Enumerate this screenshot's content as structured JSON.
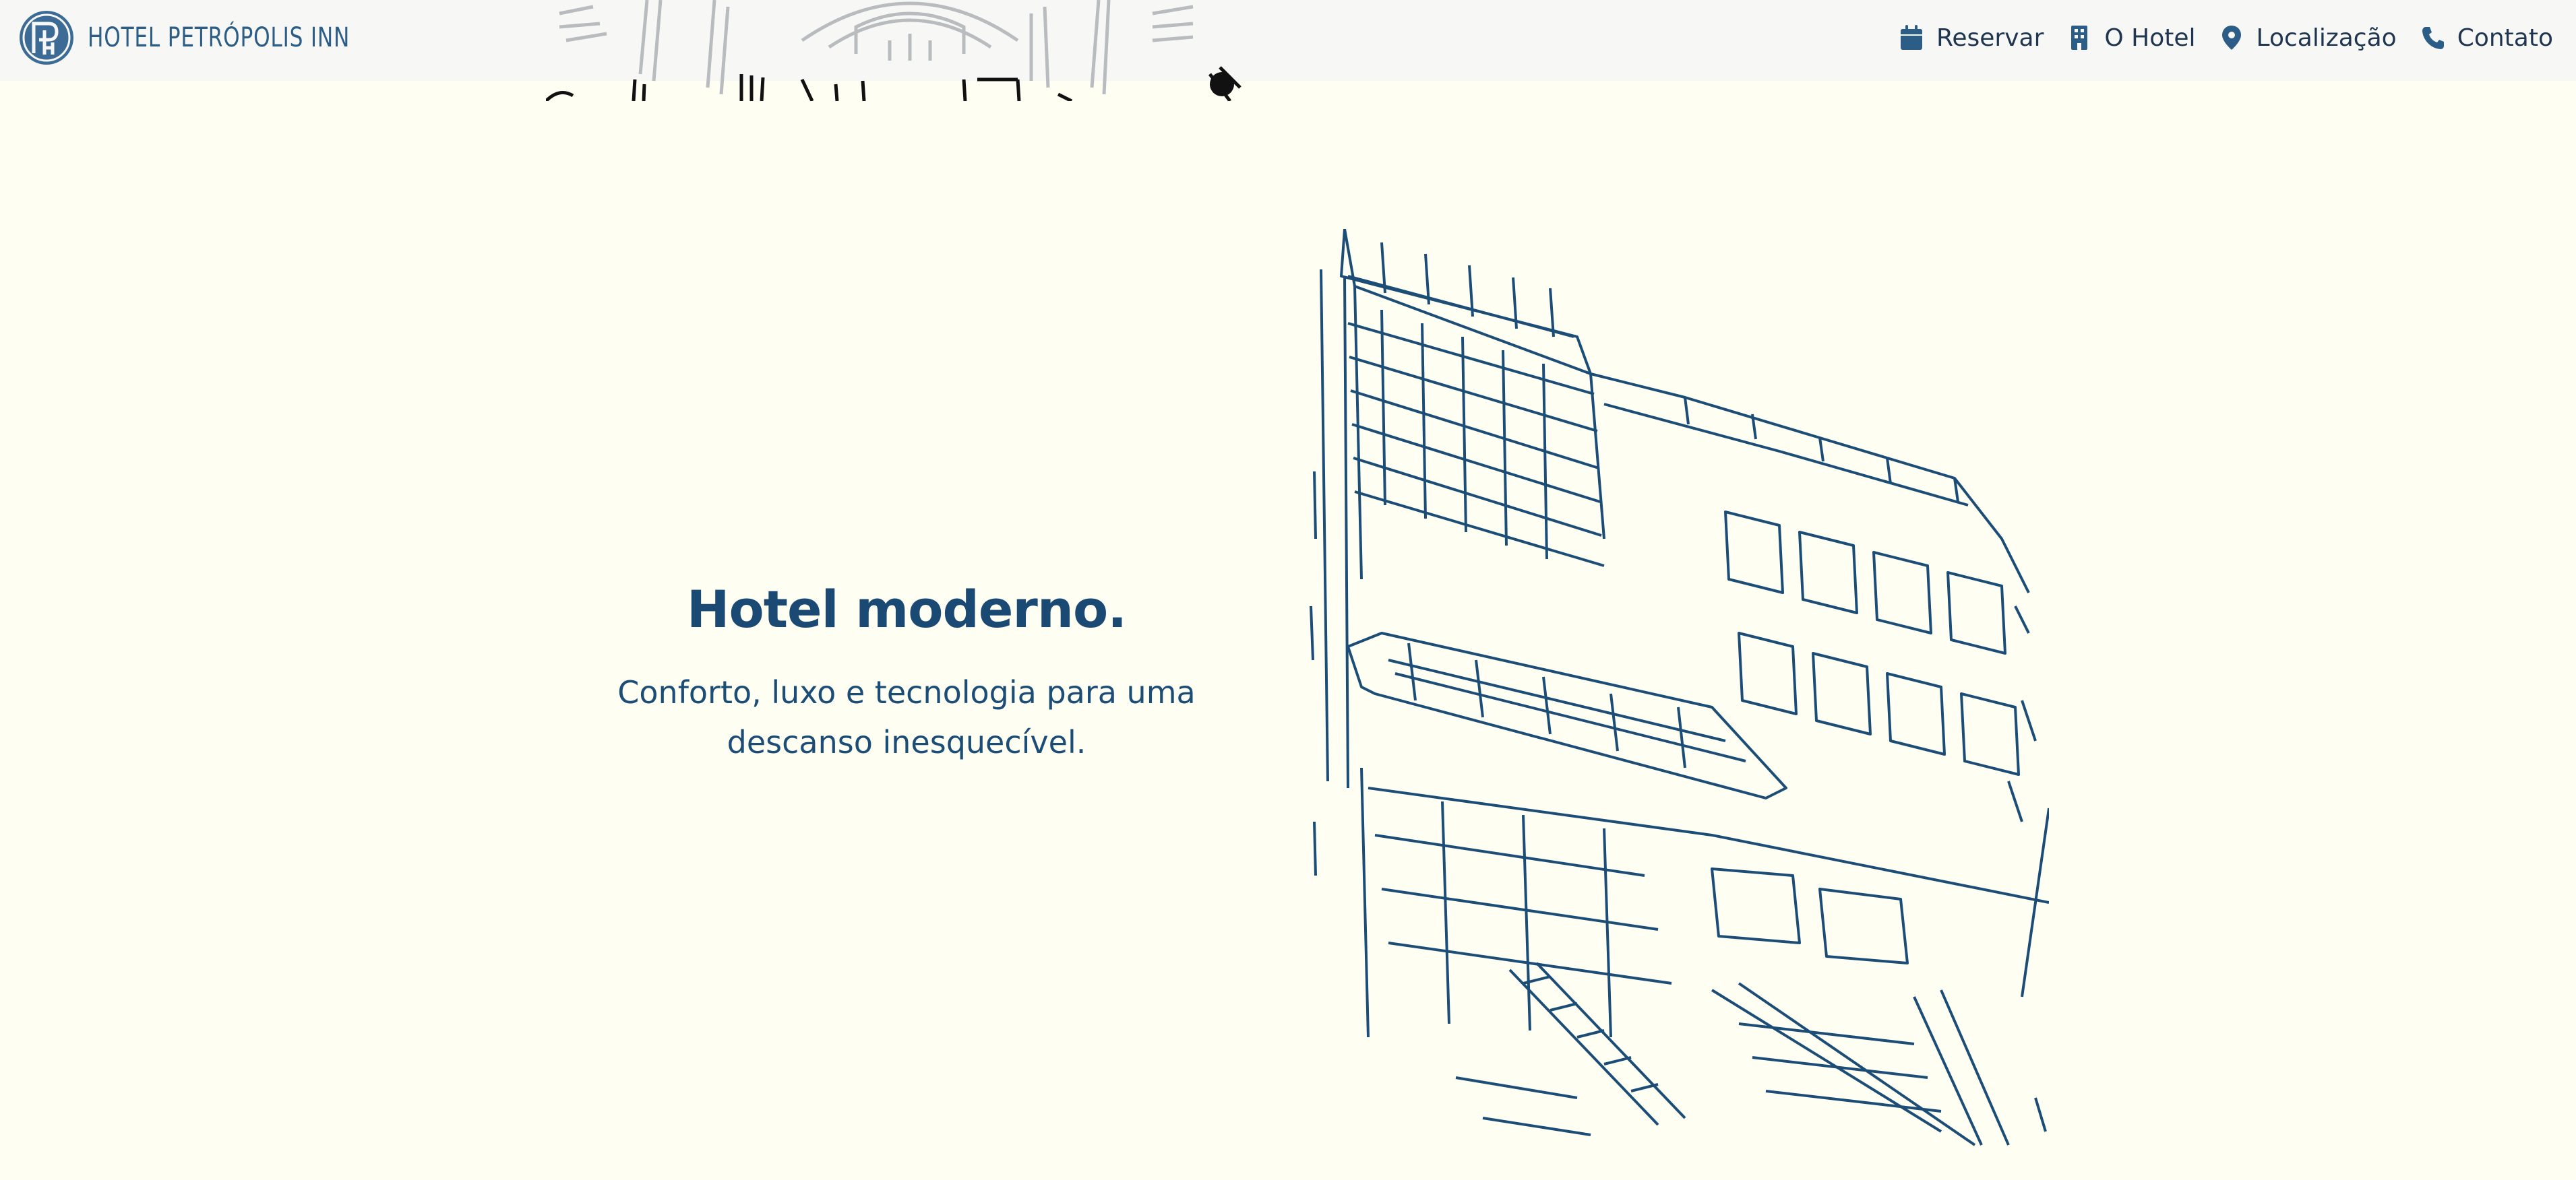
{
  "brand": {
    "name": "HOTEL PETRÓPOLIS INN",
    "logo_icon": "hotel-monogram-logo"
  },
  "nav": {
    "items": [
      {
        "label": "Reservar",
        "icon": "calendar-icon"
      },
      {
        "label": "O Hotel",
        "icon": "building-icon"
      },
      {
        "label": "Localização",
        "icon": "map-pin-icon"
      },
      {
        "label": "Contato",
        "icon": "phone-icon"
      }
    ]
  },
  "hero": {
    "title": "Hotel moderno.",
    "subtitle": "Conforto, luxo e tecnologia para uma descanso inesquecível.",
    "illustration": "hotel-building-line-drawing"
  },
  "colors": {
    "background": "#fefef3",
    "header": "#f7f8f6",
    "brand": "#2c5d87",
    "nav_text": "#1f3550",
    "heading": "#1a4a73",
    "drawing_stroke": "#1c4d77"
  }
}
